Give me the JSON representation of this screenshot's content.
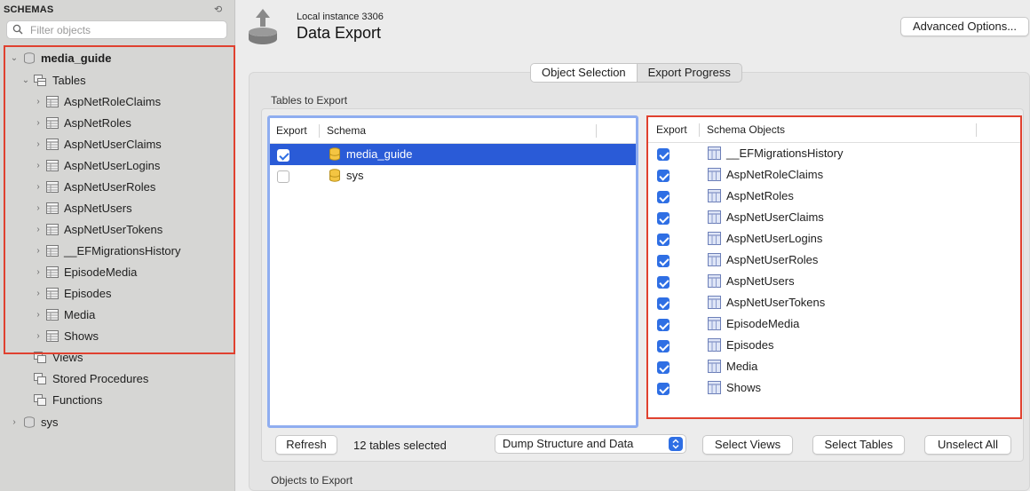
{
  "sidebar": {
    "header": "SCHEMAS",
    "filter_placeholder": "Filter objects",
    "schema_main": "media_guide",
    "tables_label": "Tables",
    "tables": [
      "AspNetRoleClaims",
      "AspNetRoles",
      "AspNetUserClaims",
      "AspNetUserLogins",
      "AspNetUserRoles",
      "AspNetUsers",
      "AspNetUserTokens",
      "__EFMigrationsHistory",
      "EpisodeMedia",
      "Episodes",
      "Media",
      "Shows"
    ],
    "views_label": "Views",
    "procedures_label": "Stored Procedures",
    "functions_label": "Functions",
    "schema_sys": "sys"
  },
  "header": {
    "subtitle": "Local instance 3306",
    "title": "Data Export",
    "advanced_button": "Advanced Options..."
  },
  "tabs": [
    "Object Selection",
    "Export Progress"
  ],
  "sections": {
    "tables_to_export": "Tables to Export",
    "objects_to_export": "Objects to Export"
  },
  "schema_table": {
    "col_export": "Export",
    "col_schema": "Schema",
    "rows": [
      {
        "name": "media_guide",
        "checked": true,
        "selected": true
      },
      {
        "name": "sys",
        "checked": false,
        "selected": false
      }
    ]
  },
  "objects_table": {
    "col_export": "Export",
    "col_objects": "Schema Objects",
    "rows": [
      "__EFMigrationsHistory",
      "AspNetRoleClaims",
      "AspNetRoles",
      "AspNetUserClaims",
      "AspNetUserLogins",
      "AspNetUserRoles",
      "AspNetUsers",
      "AspNetUserTokens",
      "EpisodeMedia",
      "Episodes",
      "Media",
      "Shows"
    ]
  },
  "footer": {
    "refresh": "Refresh",
    "status": "12 tables selected",
    "dump_option": "Dump Structure and Data",
    "select_views": "Select Views",
    "select_tables": "Select Tables",
    "unselect_all": "Unselect All"
  },
  "colors": {
    "highlight_box": "#e0412f",
    "selection": "#2a5bd7",
    "checkbox": "#2f6fe4"
  }
}
